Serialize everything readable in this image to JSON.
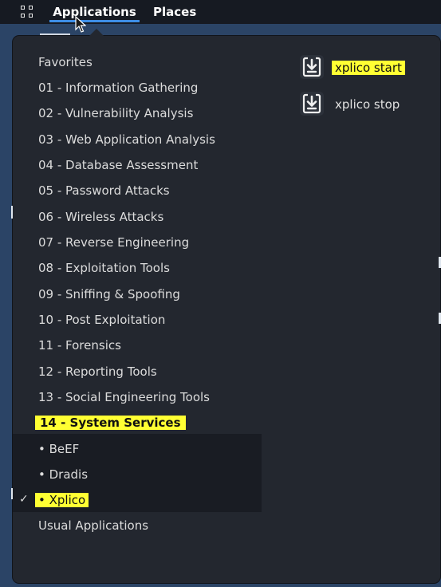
{
  "topbar": {
    "applications_label": "Applications",
    "places_label": "Places"
  },
  "categories": [
    "Favorites",
    "01 - Information Gathering",
    "02 - Vulnerability Analysis",
    "03 - Web Application Analysis",
    "04 - Database Assessment",
    "05 - Password Attacks",
    "06 - Wireless Attacks",
    "07 - Reverse Engineering",
    "08 - Exploitation Tools",
    "09 - Sniffing & Spoofing",
    "10 - Post Exploitation",
    "11 - Forensics",
    "12 - Reporting Tools",
    "13 - Social Engineering Tools",
    "14 - System Services"
  ],
  "submenu": {
    "checkmark": "✓",
    "items": [
      "• BeEF",
      "• Dradis",
      "• Xplico"
    ]
  },
  "usual": "Usual Applications",
  "apps": [
    "xplico start",
    "xplico stop"
  ],
  "colors": {
    "highlight": "#ffff33",
    "accent": "#3d8ee6",
    "menu_bg": "#23272f",
    "desktop_bg": "#2b4466"
  }
}
